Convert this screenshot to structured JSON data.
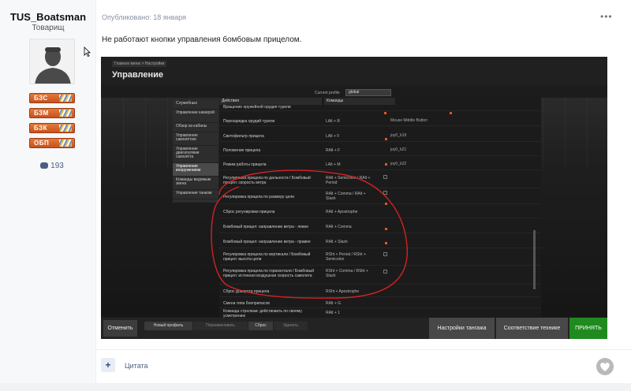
{
  "author": {
    "name": "TUS_Boatsman",
    "rank": "Товарищ",
    "badges": [
      "БЗС",
      "БЗМ",
      "БЗК",
      "ОБП"
    ],
    "reputation": "193"
  },
  "post": {
    "date": "Опубликовано: 18 января",
    "more": "•••",
    "text": "Не работают кнопки управления бомбовым прицелом."
  },
  "game": {
    "breadcrumb": "Главное меню > Настройки",
    "title": "Управление",
    "profile_label": "Current profile",
    "profile_value": "global",
    "categories": [
      "Служебные",
      "Управление камерой",
      "Обзор из кабины",
      "Управление самолётом",
      "Управление двигателями самолёта",
      "Управление вооружением",
      "Команды ведомым звена",
      "Управление танком"
    ],
    "columns": {
      "action": "Действия",
      "keys": "Команды"
    },
    "rows": [
      {
        "action": "Вращение оружейной орудия турели",
        "key": "",
        "extra": ""
      },
      {
        "action": "Перезарядка орудий турели",
        "key": "LAlt + R",
        "extra": "Mouse Middle Button"
      },
      {
        "action": "Светофильтр прицела",
        "key": "LAlt + F",
        "extra": "joy0_b19"
      },
      {
        "action": "Положение прицела",
        "key": "RAlt + F",
        "extra": "joy0_b21"
      },
      {
        "action": "Режим работы прицела",
        "key": "LAlt + M",
        "extra": "joy0_b22"
      },
      {
        "action": "Регулировка прицела по дальности / Бомбовый прицел: скорость ветра",
        "key": "RAlt + Semicolon / RAlt + Period",
        "extra": ""
      },
      {
        "action": "Регулировка прицела по размеру цели",
        "key": "RAlt + Comma / RAlt + Slash",
        "extra": ""
      },
      {
        "action": "Сброс регулировки прицела",
        "key": "RAlt + Apostrophe",
        "extra": ""
      },
      {
        "action": "Бомбовый прицел: направление ветра - левее",
        "key": "RAlt + Comma",
        "extra": ""
      },
      {
        "action": "Бомбовый прицел: направление ветра - правее",
        "key": "RAlt + Slash",
        "extra": ""
      },
      {
        "action": "Регулировка прицела по вертикали / Бомбовый прицел: высота цели",
        "key": "RSht + Period / RSht + Semicolon",
        "extra": ""
      },
      {
        "action": "Регулировка прицела по горизонтали / Бомбовый прицел: истинная воздушная скорость самолета",
        "key": "RSht + Comma / RSht + Slash",
        "extra": ""
      },
      {
        "action": "Сброс доворота прицела",
        "key": "RSht + Apostrophe",
        "extra": ""
      },
      {
        "action": "Смена типа боеприпасов",
        "key": "RAlt + G",
        "extra": ""
      },
      {
        "action": "Команда стрелкам: действовать по своему усмотрению",
        "key": "RAlt + 1",
        "extra": ""
      }
    ],
    "footer": {
      "cancel": "Отменить",
      "new_profile": "Новый профиль",
      "rename": "Переименовать",
      "reset": "Сброс",
      "delete": "Удалить",
      "pitch_settings": "Настройки тангажа",
      "tech_match": "Соответствие технике",
      "accept": "ПРИНЯТЬ"
    }
  },
  "actions": {
    "quote": "Цитата",
    "add": "+"
  },
  "colors": {
    "accent_orange": "#e05a1a",
    "accept_green": "#1f8a1f",
    "link_blue": "#4a5f80"
  }
}
